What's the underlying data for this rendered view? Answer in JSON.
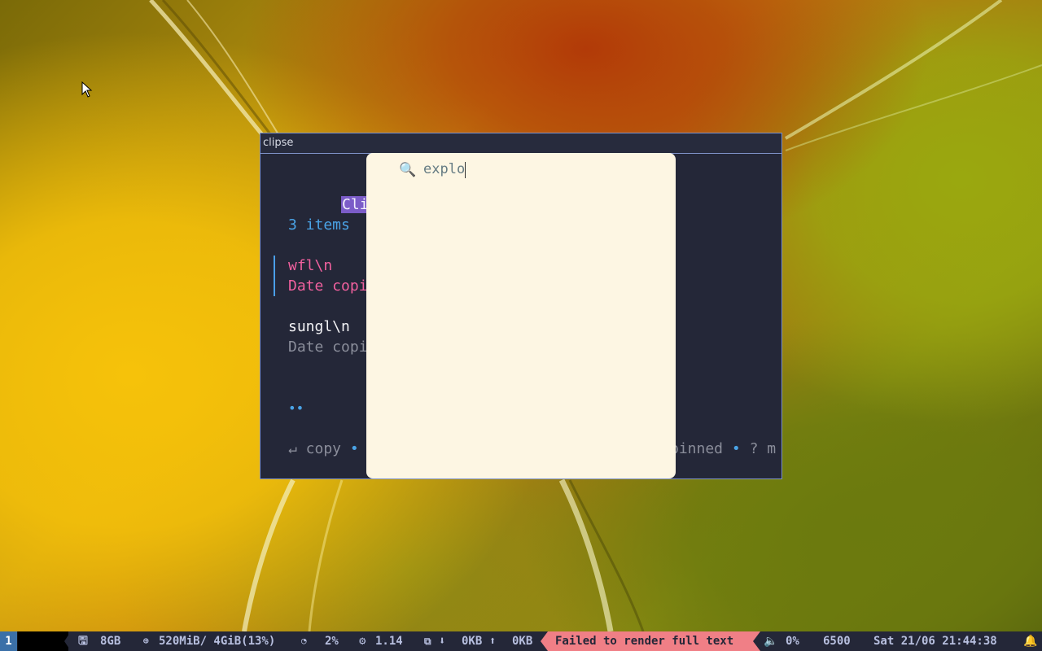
{
  "window": {
    "title": "clipse"
  },
  "clipse": {
    "header": "Clipboard",
    "count": "3 items",
    "items": [
      {
        "primary": "wfl\\n",
        "secondary": "Date copi",
        "selected": true
      },
      {
        "primary": "sungl\\n",
        "secondary": "Date copi",
        "selected": false
      }
    ],
    "pager_dots": "••",
    "help_left": "↵ copy",
    "help_sep": "•",
    "help_right_pinned": "pinned",
    "help_right_more": "? m"
  },
  "search": {
    "icon": "search-icon",
    "value": "explo"
  },
  "statusbar": {
    "workspace": "1",
    "disk_value": "8GB",
    "memory_value": "520MiB/ 4GiB(13%)",
    "cpu_value": "2%",
    "load_value": "1.14",
    "net_down": "0KB",
    "net_up": "0KB",
    "error_text": "Failed to render full text",
    "volume_value": "0%",
    "color_temp": "6500",
    "datetime": "Sat 21/06 21:44:38"
  },
  "colors": {
    "accent_purple": "#7b5cc8",
    "accent_blue": "#4aa3e6",
    "selected_pink": "#f0609e",
    "error_bg": "#f07f86",
    "popup_bg": "#fdf6e3",
    "terminal_bg": "#242738"
  }
}
